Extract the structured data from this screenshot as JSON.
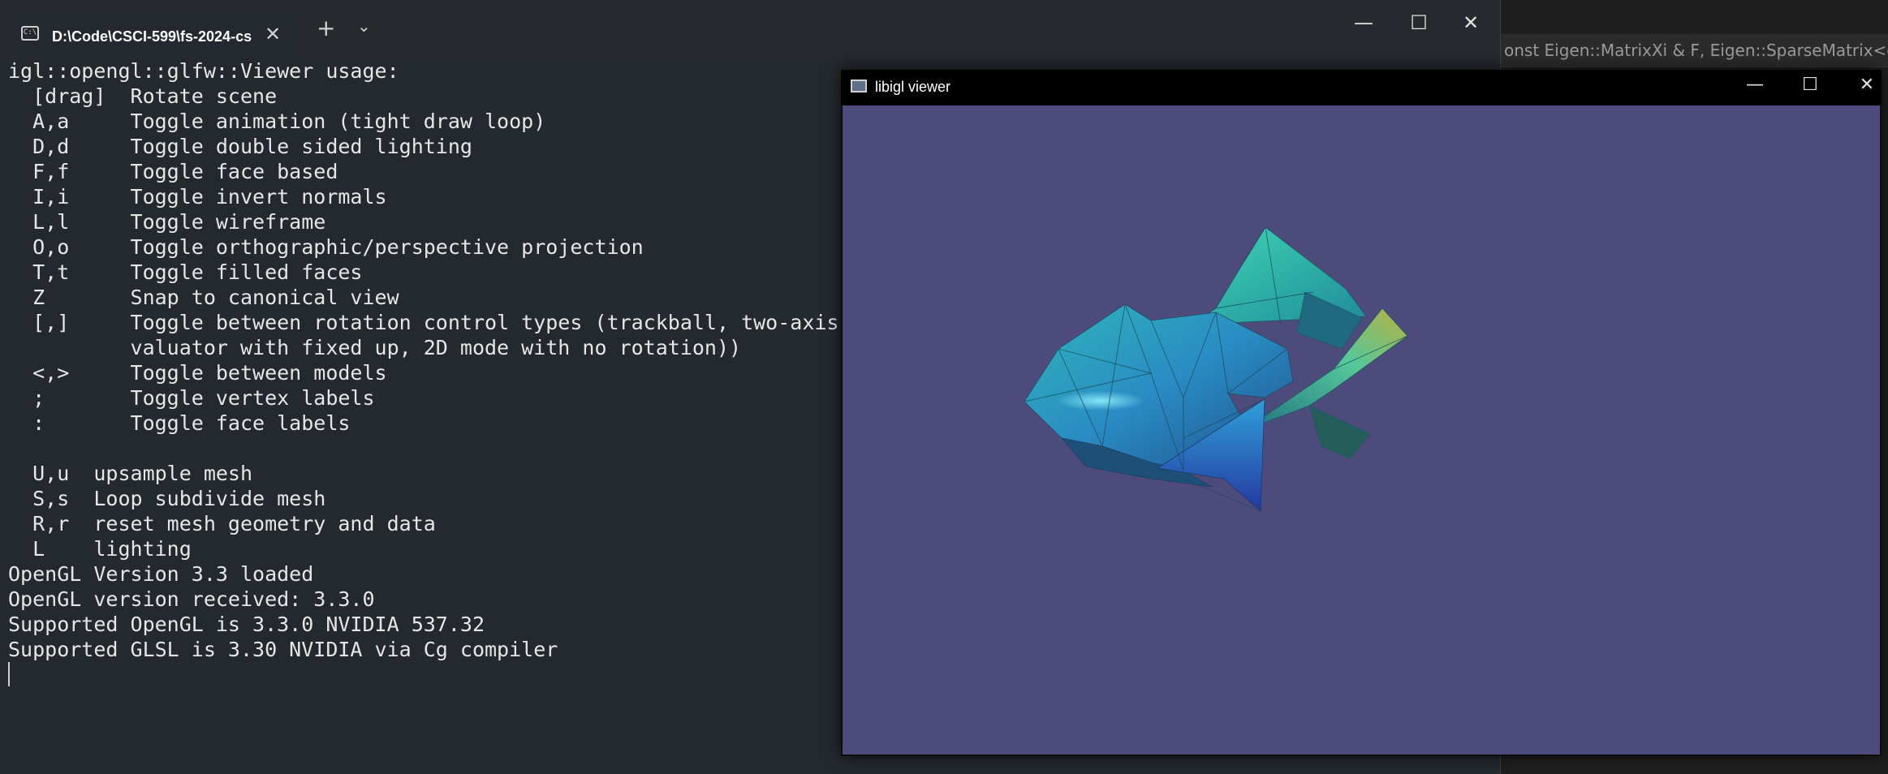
{
  "editor": {
    "visible_text": "onst Eigen::MatrixXi & F, Eigen::SparseMatrix<doub"
  },
  "terminal": {
    "tab_title": "D:\\Code\\CSCI-599\\fs-2024-cs",
    "tab_close_glyph": "✕",
    "new_tab_glyph": "+",
    "dropdown_glyph": "⌄",
    "window_controls": {
      "minimize": "—",
      "maximize": "☐",
      "close": "✕"
    },
    "lines": [
      "igl::opengl::glfw::Viewer usage:",
      "  [drag]  Rotate scene",
      "  A,a     Toggle animation (tight draw loop)",
      "  D,d     Toggle double sided lighting",
      "  F,f     Toggle face based",
      "  I,i     Toggle invert normals",
      "  L,l     Toggle wireframe",
      "  O,o     Toggle orthographic/perspective projection",
      "  T,t     Toggle filled faces",
      "  Z       Snap to canonical view",
      "  [,]     Toggle between rotation control types (trackball, two-axis",
      "          valuator with fixed up, 2D mode with no rotation))",
      "  <,>     Toggle between models",
      "  ;       Toggle vertex labels",
      "  :       Toggle face labels",
      "",
      "  U,u  upsample mesh",
      "  S,s  Loop subdivide mesh",
      "  R,r  reset mesh geometry and data",
      "  L    lighting",
      "OpenGL Version 3.3 loaded",
      "OpenGL version received: 3.3.0",
      "Supported OpenGL is 3.3.0 NVIDIA 537.32",
      "Supported GLSL is 3.30 NVIDIA via Cg compiler"
    ]
  },
  "viewer": {
    "title": "libigl viewer",
    "window_controls": {
      "minimize": "—",
      "maximize": "☐",
      "close": "✕"
    },
    "background_color": "#4d4a7c"
  }
}
